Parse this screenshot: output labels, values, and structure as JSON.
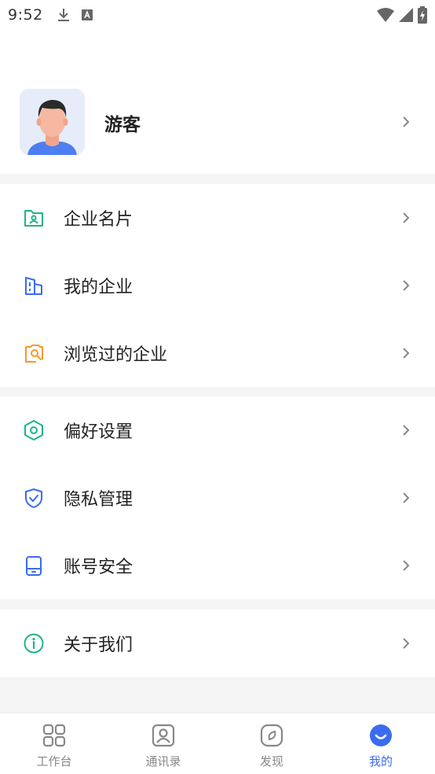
{
  "status_bar": {
    "time": "9:52"
  },
  "profile": {
    "name": "游客"
  },
  "menu_groups": [
    {
      "items": [
        {
          "label": "企业名片",
          "icon": "business-card-icon",
          "color": "#1fb38a"
        },
        {
          "label": "我的企业",
          "icon": "building-icon",
          "color": "#3b6cf0"
        },
        {
          "label": "浏览过的企业",
          "icon": "browse-history-icon",
          "color": "#f29a2e"
        }
      ]
    },
    {
      "items": [
        {
          "label": "偏好设置",
          "icon": "settings-hexagon-icon",
          "color": "#1fb38a"
        },
        {
          "label": "隐私管理",
          "icon": "privacy-shield-icon",
          "color": "#3b6cf0"
        },
        {
          "label": "账号安全",
          "icon": "account-phone-icon",
          "color": "#3b6cf0"
        }
      ]
    },
    {
      "items": [
        {
          "label": "关于我们",
          "icon": "info-icon",
          "color": "#1fb38a"
        }
      ]
    }
  ],
  "tab_bar": {
    "tabs": [
      {
        "label": "工作台",
        "icon": "grid-icon",
        "active": false
      },
      {
        "label": "通讯录",
        "icon": "contacts-icon",
        "active": false
      },
      {
        "label": "发现",
        "icon": "compass-icon",
        "active": false
      },
      {
        "label": "我的",
        "icon": "profile-smile-icon",
        "active": true
      }
    ]
  },
  "colors": {
    "accent": "#3b6cf0",
    "green": "#1fb38a",
    "orange": "#f29a2e"
  }
}
